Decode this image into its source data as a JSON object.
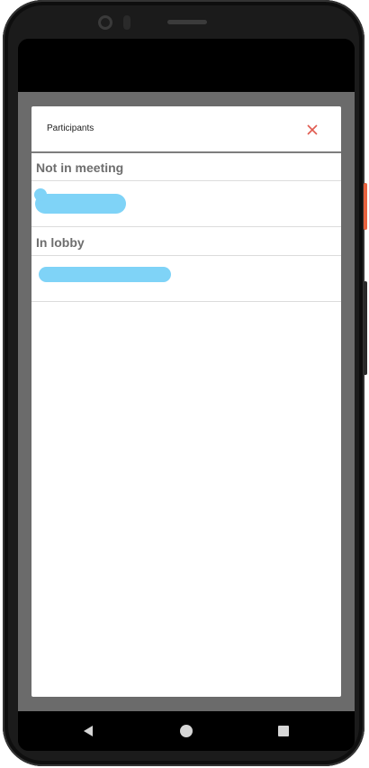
{
  "dialog": {
    "title": "Participants",
    "close_icon": "close-icon",
    "accent_color": "#e05a4f"
  },
  "sections": [
    {
      "title": "Not in meeting",
      "participants": [
        {
          "name_redacted": true
        }
      ]
    },
    {
      "title": "In lobby",
      "participants": [
        {
          "name_redacted": true
        }
      ]
    }
  ],
  "navbar": {
    "back_icon": "back-triangle-icon",
    "home_icon": "home-circle-icon",
    "recents_icon": "recents-square-icon"
  }
}
